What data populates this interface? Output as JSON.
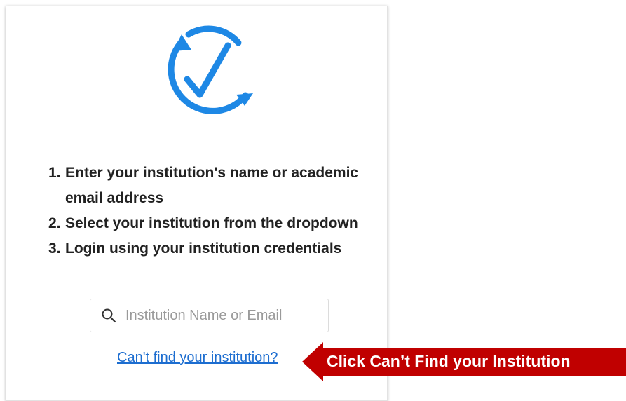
{
  "logo": {
    "icon": "circular-checkmark-icon",
    "color": "#1e88e5"
  },
  "instructions": [
    {
      "num": "1.",
      "text": "Enter your institution's name or academic email address"
    },
    {
      "num": "2.",
      "text": "Select your institution from the dropdown"
    },
    {
      "num": "3.",
      "text": "Login using your institution credentials"
    }
  ],
  "search": {
    "placeholder": "Institution Name or Email",
    "value": "",
    "icon": "search-icon"
  },
  "cant_find_link": "Can't find your institution?",
  "callout": {
    "text": "Click Can’t Find your Institution",
    "color": "#c00000",
    "icon": "arrow-left-icon"
  }
}
